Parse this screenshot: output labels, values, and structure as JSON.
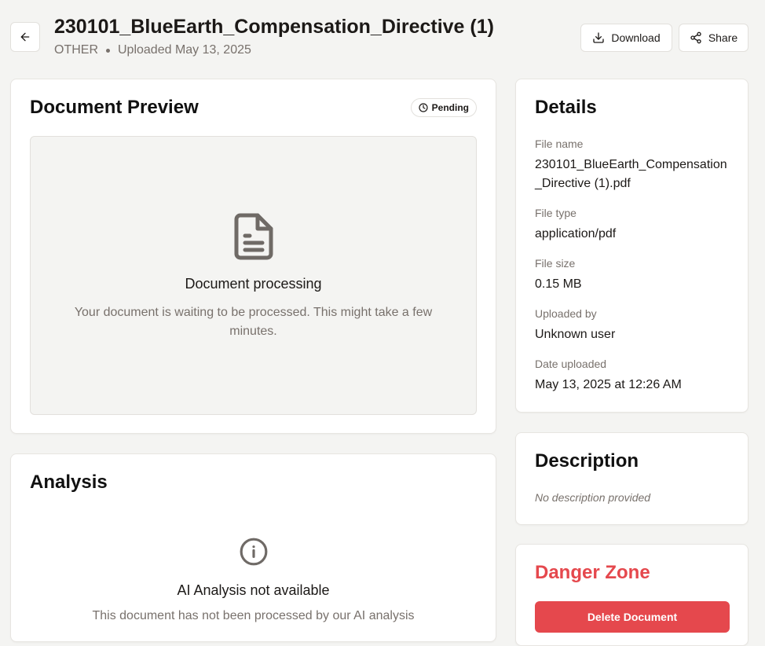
{
  "header": {
    "back_icon": "arrow-left-icon",
    "title": "230101_BlueEarth_Compensation_Directive (1)",
    "category": "OTHER",
    "uploaded": "Uploaded May 13, 2025",
    "download_label": "Download",
    "share_label": "Share"
  },
  "preview": {
    "title": "Document Preview",
    "status": "Pending",
    "status_icon": "clock-icon",
    "doc_icon": "file-text-icon",
    "processing_title": "Document processing",
    "processing_text": "Your document is waiting to be processed. This might take a few minutes."
  },
  "analysis": {
    "title": "Analysis",
    "icon": "info-icon",
    "unavailable_title": "AI Analysis not available",
    "unavailable_text": "This document has not been processed by our AI analysis"
  },
  "details": {
    "title": "Details",
    "file_name_label": "File name",
    "file_name": "230101_BlueEarth_Compensation_Directive (1).pdf",
    "file_type_label": "File type",
    "file_type": "application/pdf",
    "file_size_label": "File size",
    "file_size": "0.15 MB",
    "uploaded_by_label": "Uploaded by",
    "uploaded_by": "Unknown user",
    "date_uploaded_label": "Date uploaded",
    "date_uploaded": "May 13, 2025 at 12:26 AM"
  },
  "description": {
    "title": "Description",
    "text": "No description provided"
  },
  "danger": {
    "title": "Danger Zone",
    "delete_label": "Delete Document"
  },
  "colors": {
    "background": "#f4f4f2",
    "danger": "#e5484d",
    "muted_text": "#78716c",
    "icon": "#6f6a66"
  }
}
